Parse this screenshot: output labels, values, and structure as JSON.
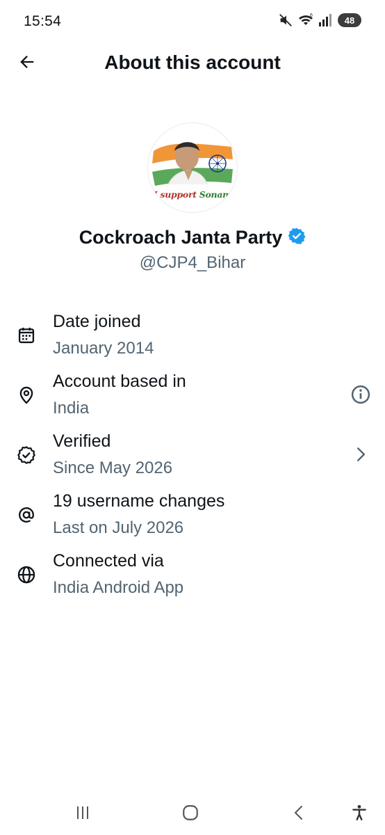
{
  "status_bar": {
    "time": "15:54",
    "battery": "48",
    "icons": [
      "mute-icon",
      "wifi-icon",
      "signal-icon",
      "battery-icon"
    ]
  },
  "header": {
    "title": "About this account",
    "back_icon": "arrow-left-icon"
  },
  "profile": {
    "avatar_caption_prefix": "I support",
    "avatar_caption_name": "Sonam",
    "display_name": "Cockroach Janta Party",
    "handle": "@CJP4_Bihar",
    "verified_color": "#1d9bf0"
  },
  "info": [
    {
      "icon": "calendar-icon",
      "title": "Date joined",
      "subtitle": "January 2014"
    },
    {
      "icon": "location-pin-icon",
      "title": "Account based in",
      "subtitle": "India",
      "trail_icon": "info-icon"
    },
    {
      "icon": "verified-badge-icon",
      "title": "Verified",
      "subtitle": "Since May 2026",
      "trail_icon": "chevron-right-icon"
    },
    {
      "icon": "at-sign-icon",
      "title": "19 username changes",
      "subtitle": "Last on July 2026"
    },
    {
      "icon": "globe-icon",
      "title": "Connected via",
      "subtitle": "India Android App"
    }
  ],
  "nav_bar": {
    "icons": [
      "recent-apps-icon",
      "home-icon",
      "back-icon",
      "accessibility-icon"
    ]
  },
  "colors": {
    "text_primary": "#0f1419",
    "text_secondary": "#536471",
    "accent": "#1d9bf0"
  }
}
